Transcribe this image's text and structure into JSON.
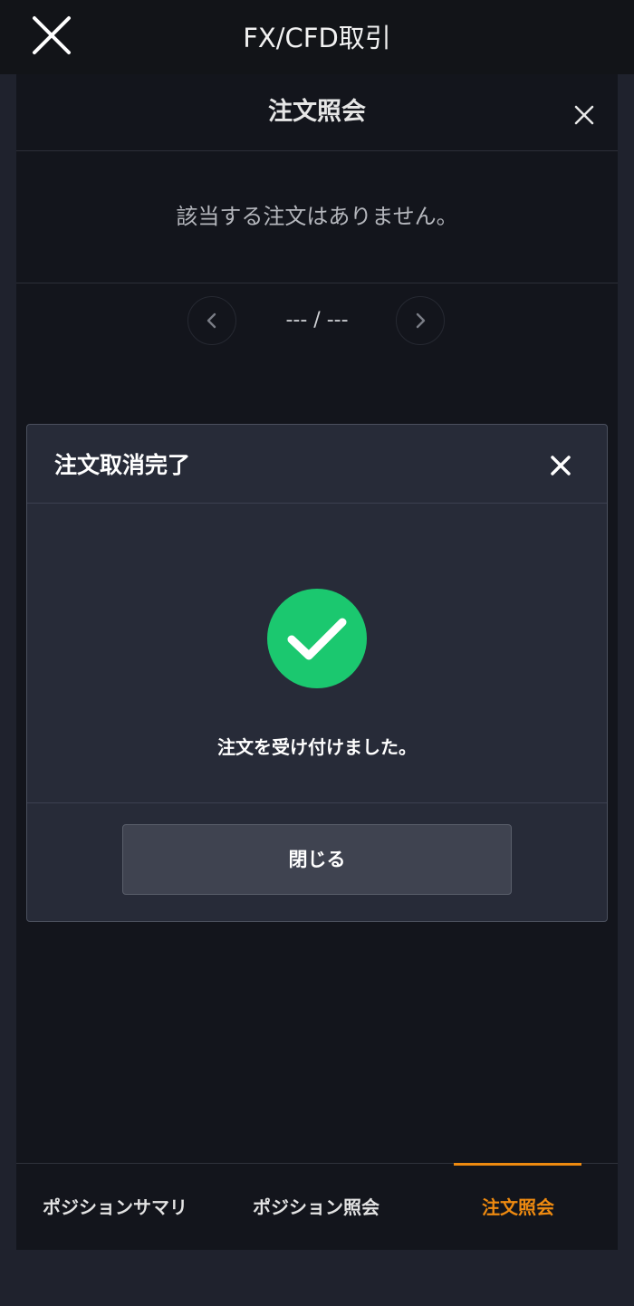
{
  "app": {
    "title": "FX/CFD取引"
  },
  "panel": {
    "title": "注文照会",
    "empty_message": "該当する注文はありません。",
    "pager": {
      "text": "--- / ---"
    }
  },
  "dialog": {
    "title": "注文取消完了",
    "message": "注文を受け付けました。",
    "close_button_label": "閉じる",
    "success_color": "#1bc86f"
  },
  "tabs": [
    {
      "label": "ポジションサマリ",
      "active": false
    },
    {
      "label": "ポジション照会",
      "active": false
    },
    {
      "label": "注文照会",
      "active": true
    }
  ],
  "colors": {
    "accent": "#ee8a10",
    "success": "#1bc86f",
    "background": "#13151c"
  }
}
